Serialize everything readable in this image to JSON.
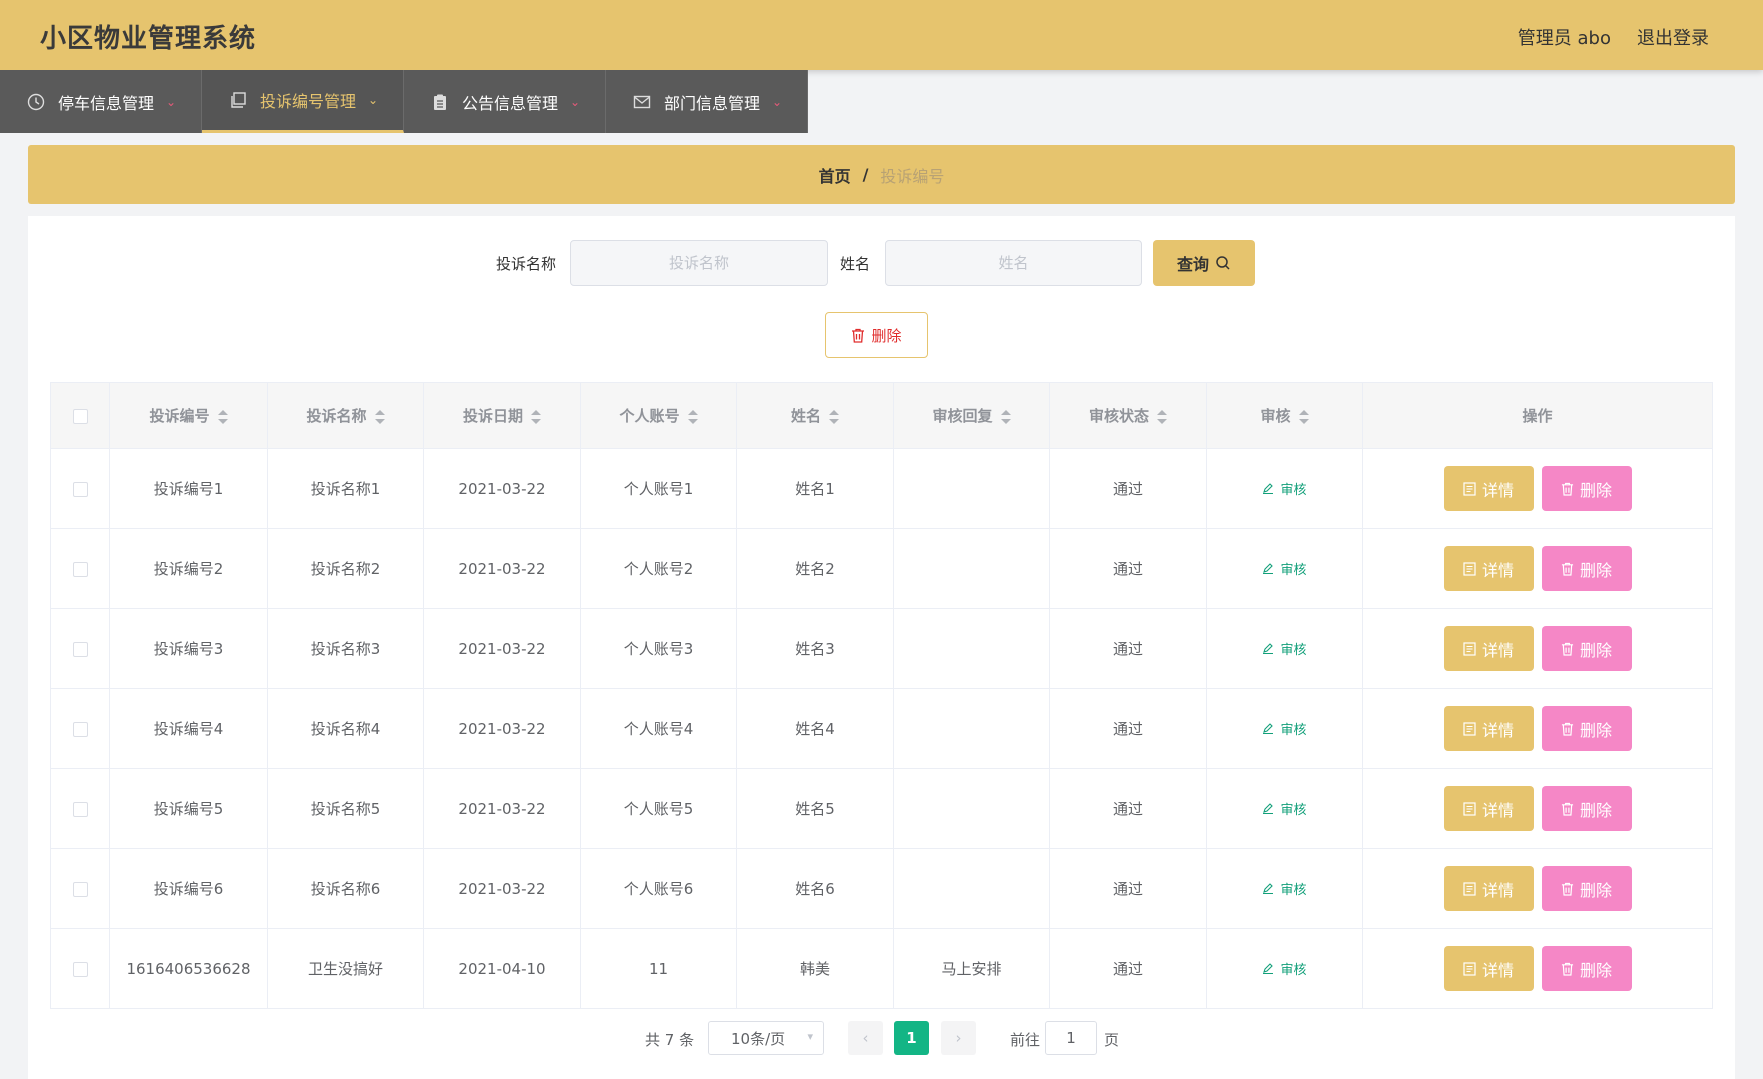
{
  "header": {
    "title": "小区物业管理系统",
    "user": "管理员 abo",
    "logout": "退出登录"
  },
  "nav": [
    {
      "label": "停车信息管理",
      "icon": "clock-icon"
    },
    {
      "label": "投诉编号管理",
      "icon": "copy-icon"
    },
    {
      "label": "公告信息管理",
      "icon": "clipboard-icon"
    },
    {
      "label": "部门信息管理",
      "icon": "mail-icon"
    }
  ],
  "breadcrumb": {
    "home": "首页",
    "sep": "/",
    "current": "投诉编号"
  },
  "search": {
    "name_label": "投诉名称",
    "name_placeholder": "投诉名称",
    "person_label": "姓名",
    "person_placeholder": "姓名",
    "query_label": "查询"
  },
  "bulk_delete_label": "删除",
  "table": {
    "headers": [
      "投诉编号",
      "投诉名称",
      "投诉日期",
      "个人账号",
      "姓名",
      "审核回复",
      "审核状态",
      "审核",
      "操作"
    ],
    "review_label": "审核",
    "detail_label": "详情",
    "delete_label": "删除",
    "rows": [
      [
        "投诉编号1",
        "投诉名称1",
        "2021-03-22",
        "个人账号1",
        "姓名1",
        "",
        "通过"
      ],
      [
        "投诉编号2",
        "投诉名称2",
        "2021-03-22",
        "个人账号2",
        "姓名2",
        "",
        "通过"
      ],
      [
        "投诉编号3",
        "投诉名称3",
        "2021-03-22",
        "个人账号3",
        "姓名3",
        "",
        "通过"
      ],
      [
        "投诉编号4",
        "投诉名称4",
        "2021-03-22",
        "个人账号4",
        "姓名4",
        "",
        "通过"
      ],
      [
        "投诉编号5",
        "投诉名称5",
        "2021-03-22",
        "个人账号5",
        "姓名5",
        "",
        "通过"
      ],
      [
        "投诉编号6",
        "投诉名称6",
        "2021-03-22",
        "个人账号6",
        "姓名6",
        "",
        "通过"
      ],
      [
        "1616406536628",
        "卫生没搞好",
        "2021-04-10",
        "11",
        "韩美",
        "马上安排",
        "通过"
      ]
    ]
  },
  "pager": {
    "total": "共 7 条",
    "page_size": "10条/页",
    "current_page": "1",
    "goto_label": "前往",
    "goto_value": "1",
    "page_unit": "页"
  }
}
